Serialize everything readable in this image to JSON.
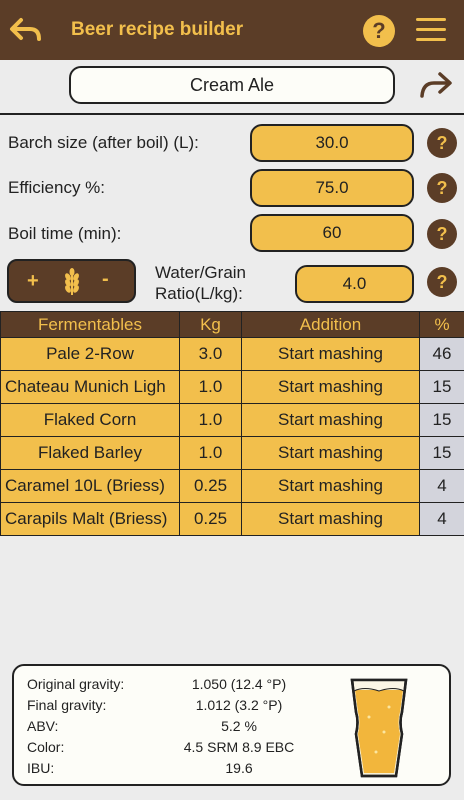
{
  "header": {
    "title": "Beer recipe builder",
    "help_label": "?"
  },
  "recipe": {
    "name": "Cream Ale"
  },
  "fields": [
    {
      "label": "Barch size (after boil) (L):",
      "value": "30.0"
    },
    {
      "label": "Efficiency %:",
      "value": "75.0"
    },
    {
      "label": "Boil time (min):",
      "value": "60"
    }
  ],
  "grain_controls": {
    "plus": "+",
    "minus": "-"
  },
  "water_ratio": {
    "label_line1": "Water/Grain",
    "label_line2": "Ratio(L/kg):",
    "value": "4.0"
  },
  "help_glyph": "?",
  "fermentables": {
    "columns": [
      "Fermentables",
      "Kg",
      "Addition",
      "%"
    ],
    "rows": [
      {
        "name": "Pale 2-Row",
        "kg": "3.0",
        "addition": "Start mashing",
        "pct": "46"
      },
      {
        "name": "Chateau Munich Ligh",
        "kg": "1.0",
        "addition": "Start mashing",
        "pct": "15"
      },
      {
        "name": "Flaked Corn",
        "kg": "1.0",
        "addition": "Start mashing",
        "pct": "15"
      },
      {
        "name": "Flaked Barley",
        "kg": "1.0",
        "addition": "Start mashing",
        "pct": "15"
      },
      {
        "name": "Caramel 10L (Briess)",
        "kg": "0.25",
        "addition": "Start mashing",
        "pct": "4"
      },
      {
        "name": "Carapils Malt (Briess)",
        "kg": "0.25",
        "addition": "Start mashing",
        "pct": "4"
      }
    ]
  },
  "summary": {
    "og_label": "Original gravity:",
    "og_value": "1.050 (12.4 °P)",
    "fg_label": "Final gravity:",
    "fg_value": "1.012 (3.2 °P)",
    "abv_label": "ABV:",
    "abv_value": "5.2 %",
    "color_label": "Color:",
    "color_value": "4.5 SRM 8.9 EBC",
    "ibu_label": "IBU:",
    "ibu_value": "19.6"
  },
  "colors": {
    "brown": "#5b3d27",
    "gold": "#f2bf4c",
    "pct_cell": "#d3d4dc",
    "background": "#ececec"
  },
  "icons": [
    "back-arrow-icon",
    "help-icon",
    "menu-icon",
    "share-arrow-icon",
    "wheat-icon",
    "beer-glass-icon"
  ]
}
